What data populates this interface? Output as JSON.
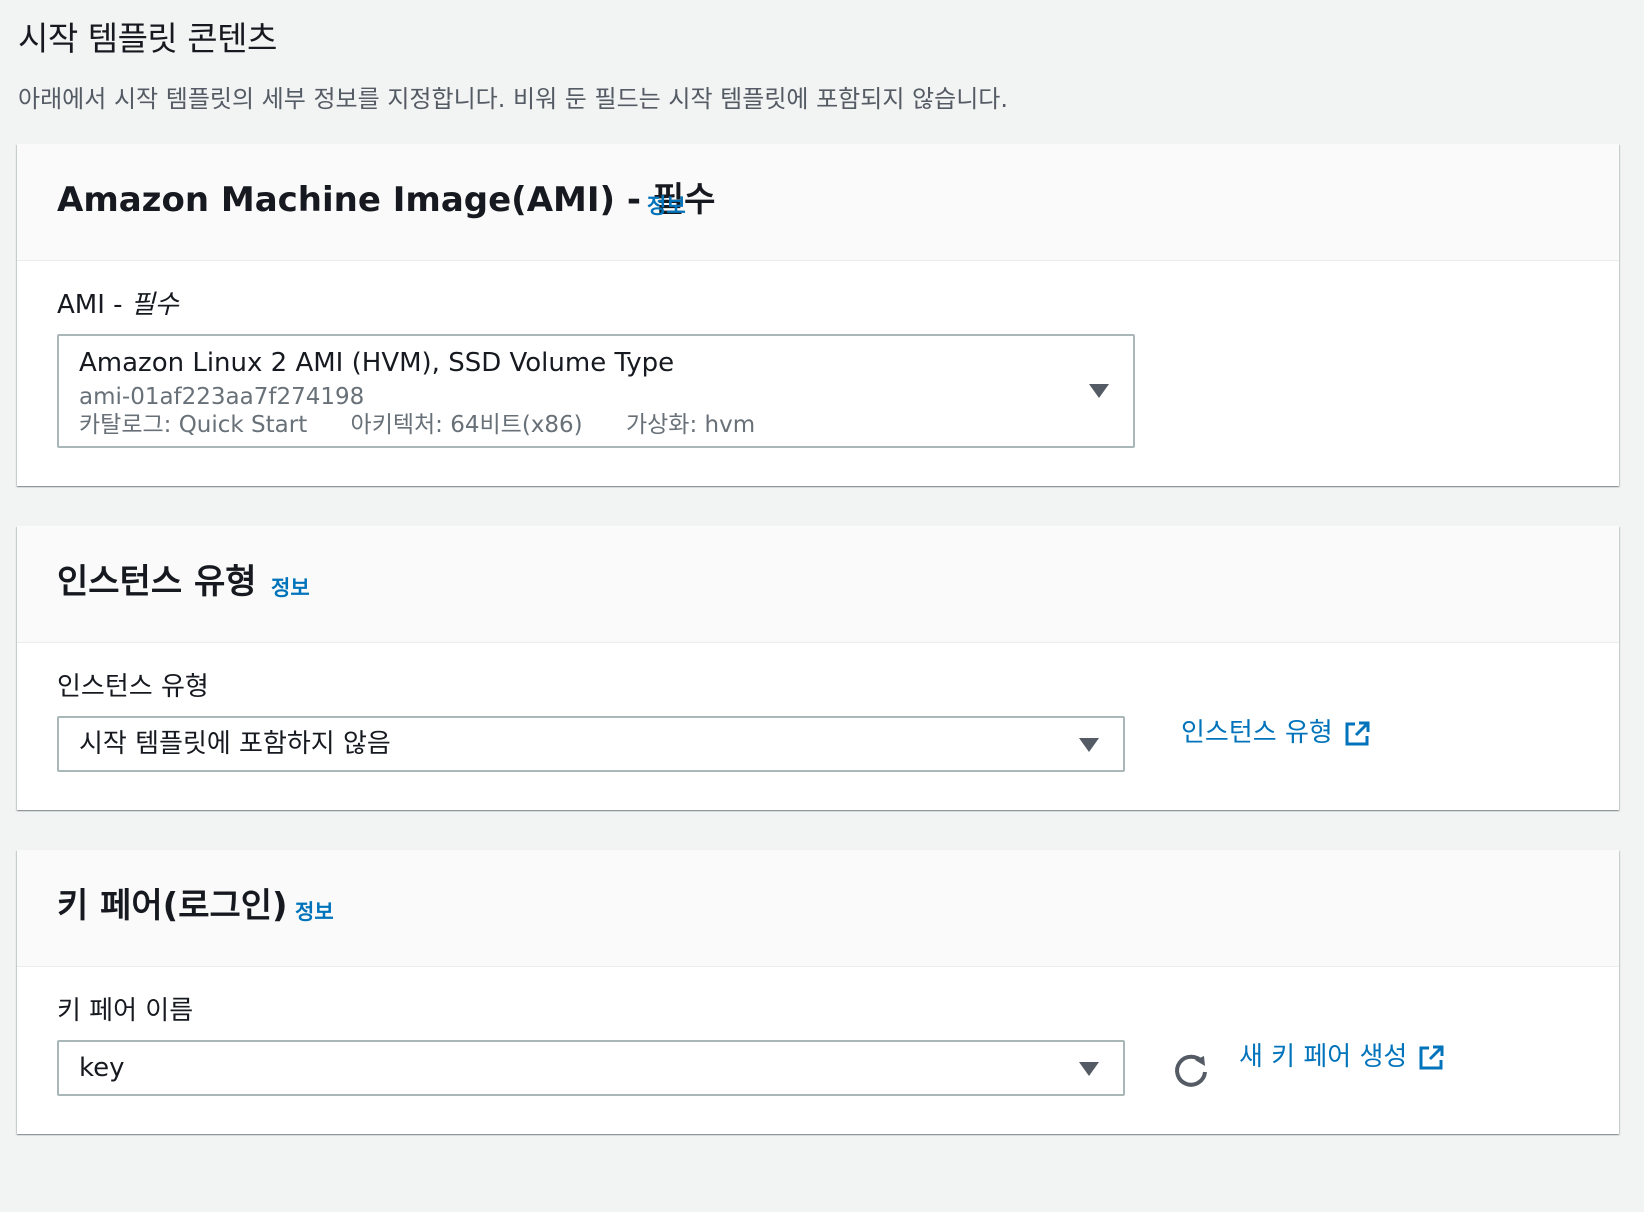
{
  "page": {
    "title": "시작 템플릿 콘텐츠",
    "description": "아래에서 시작 템플릿의 세부 정보를 지정합니다. 비워 둔 필드는 시작 템플릿에 포함되지 않습니다."
  },
  "ami_panel": {
    "title": "Amazon Machine Image(AMI) - 필수",
    "info_label": "정보",
    "field_label": "AMI - ",
    "field_label_required": "필수",
    "selected": {
      "name": "Amazon Linux 2 AMI (HVM), SSD Volume Type",
      "id": "ami-01af223aa7f274198",
      "catalog": "카탈로그: Quick Start",
      "architecture": "아키텍처: 64비트(x86)",
      "virtualization": "가상화: hvm"
    }
  },
  "instance_panel": {
    "title": "인스턴스 유형",
    "info_label": "정보",
    "field_label": "인스턴스 유형",
    "selected": "시작 템플릿에 포함하지 않음",
    "side_link": "인스턴스 유형"
  },
  "keypair_panel": {
    "title": "키 페어(로그인)",
    "info_label": "정보",
    "field_label": "키 페어 이름",
    "selected": "key",
    "side_link": "새 키 페어 생성"
  },
  "colors": {
    "link": "#0073bb",
    "background": "#f2f3f3",
    "border": "#aab7b8"
  },
  "icons": {
    "dropdown": "caret-down-icon",
    "external": "external-link-icon",
    "refresh": "refresh-icon"
  }
}
